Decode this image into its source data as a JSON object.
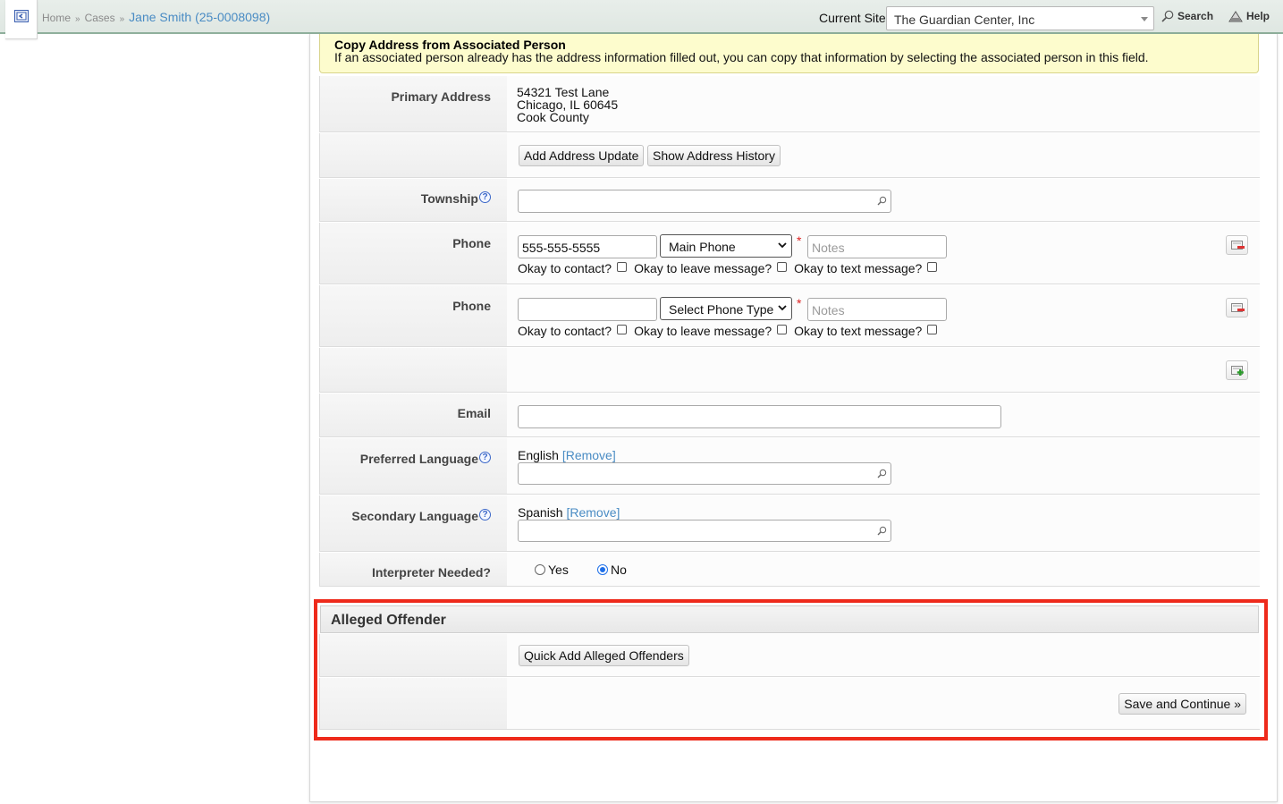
{
  "topbar": {
    "breadcrumb": [
      {
        "label": "Home"
      },
      {
        "label": "Cases"
      }
    ],
    "breadcrumb_separator": "»",
    "current_case": "Jane Smith (25-0008098)",
    "current_site_label": "Current Site",
    "current_site_value": "The Guardian Center, Inc",
    "search_label": "Search",
    "help_label": "Help"
  },
  "notice": {
    "title": "Copy Address from Associated Person",
    "text": "If an associated person already has the address information filled out, you can copy that information by selecting the associated person in this field."
  },
  "form": {
    "primary_address": {
      "label": "Primary Address",
      "lines": [
        "54321 Test Lane",
        "Chicago, IL 60645",
        "Cook County"
      ]
    },
    "address_buttons": {
      "add_update": "Add Address Update",
      "show_history": "Show Address History"
    },
    "township": {
      "label": "Township",
      "value": ""
    },
    "phones": [
      {
        "label": "Phone",
        "number": "555-555-5555",
        "type": "Main Phone",
        "notes_placeholder": "Notes",
        "required_mark": "*",
        "consent": {
          "contact": "Okay to contact?",
          "leave_message": "Okay to leave message?",
          "text_message": "Okay to text message?"
        }
      },
      {
        "label": "Phone",
        "number": "",
        "type": "Select Phone Type",
        "notes_placeholder": "Notes",
        "required_mark": "*",
        "consent": {
          "contact": "Okay to contact?",
          "leave_message": "Okay to leave message?",
          "text_message": "Okay to text message?"
        }
      }
    ],
    "email": {
      "label": "Email",
      "value": ""
    },
    "preferred_language": {
      "label": "Preferred Language",
      "value": "English",
      "remove": "[Remove]"
    },
    "secondary_language": {
      "label": "Secondary Language",
      "value": "Spanish",
      "remove": "[Remove]"
    },
    "interpreter": {
      "label": "Interpreter Needed?",
      "options": [
        "Yes",
        "No"
      ],
      "selected": "No"
    }
  },
  "alleged_offender": {
    "title": "Alleged Offender",
    "quick_add": "Quick Add Alleged Offenders",
    "save_continue": "Save and Continue »"
  },
  "colors": {
    "highlight": "#ee2a1b",
    "link": "#4a8cc4",
    "notice_bg": "#fdfccd",
    "topbar_accent": "#8fb09c"
  }
}
